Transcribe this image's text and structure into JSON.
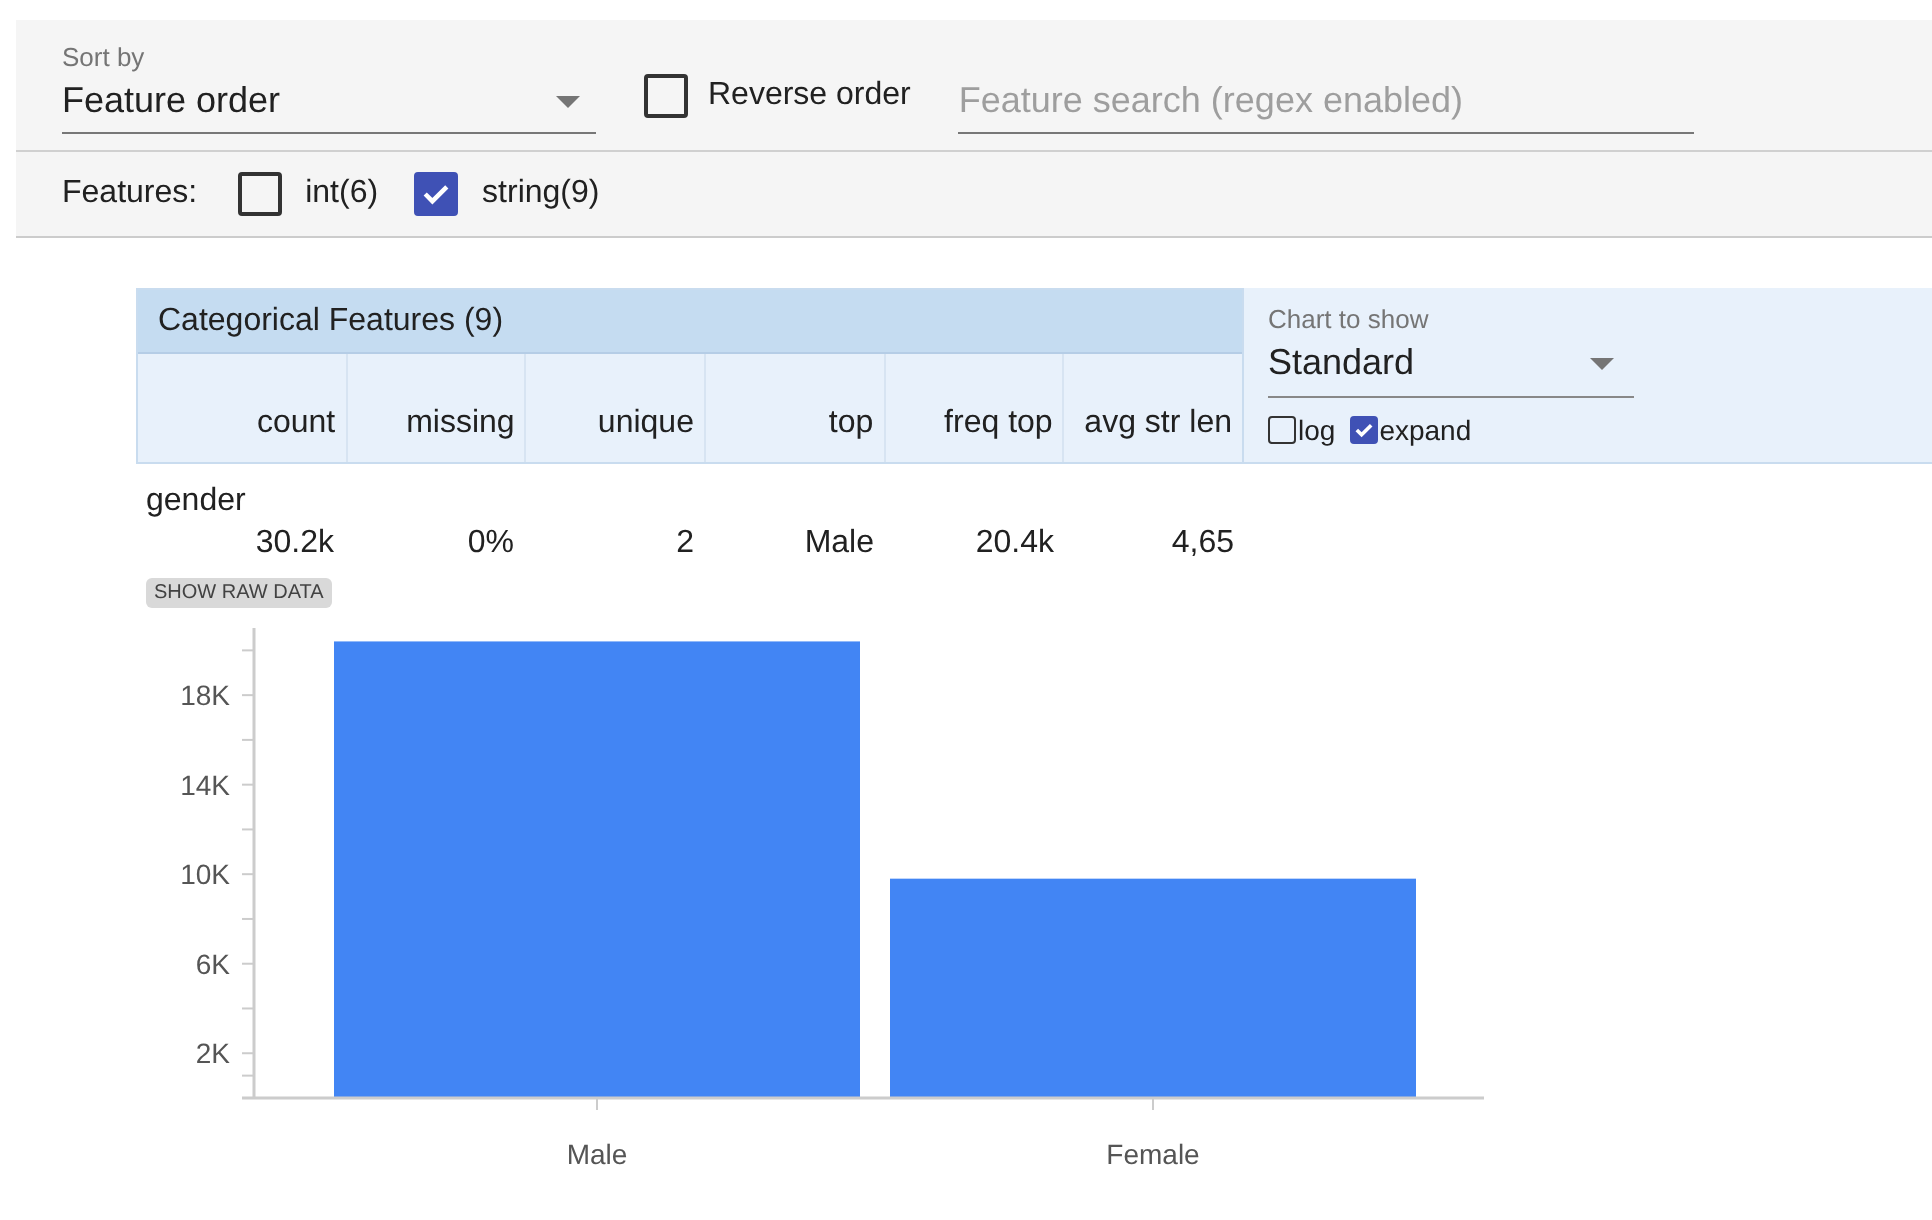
{
  "sort": {
    "label": "Sort by",
    "value": "Feature order"
  },
  "reverse": {
    "label": "Reverse order",
    "checked": false
  },
  "search": {
    "placeholder": "Feature search (regex enabled)"
  },
  "features": {
    "label": "Features:",
    "types": [
      {
        "label": "int(6)",
        "checked": false
      },
      {
        "label": "string(9)",
        "checked": true
      }
    ]
  },
  "table": {
    "title": "Categorical Features (9)",
    "columns": [
      "count",
      "missing",
      "unique",
      "top",
      "freq top",
      "avg str len"
    ],
    "chart_select": {
      "label": "Chart to show",
      "value": "Standard"
    },
    "options": [
      {
        "label": "log",
        "checked": false
      },
      {
        "label": "expand",
        "checked": true
      }
    ],
    "rows": [
      {
        "name": "gender",
        "cells": [
          "30.2k",
          "0%",
          "2",
          "Male",
          "20.4k",
          "4,65"
        ],
        "button": "SHOW RAW DATA",
        "chart_data": {
          "type": "bar",
          "categories": [
            "Male",
            "Female"
          ],
          "values": [
            20400,
            9800
          ],
          "ylim": [
            0,
            21000
          ],
          "yticks": [
            {
              "value": 2000,
              "label": "2K"
            },
            {
              "value": 6000,
              "label": "6K"
            },
            {
              "value": 10000,
              "label": "10K"
            },
            {
              "value": 14000,
              "label": "14K"
            },
            {
              "value": 18000,
              "label": "18K"
            }
          ],
          "color": "#4285f4"
        }
      }
    ]
  }
}
